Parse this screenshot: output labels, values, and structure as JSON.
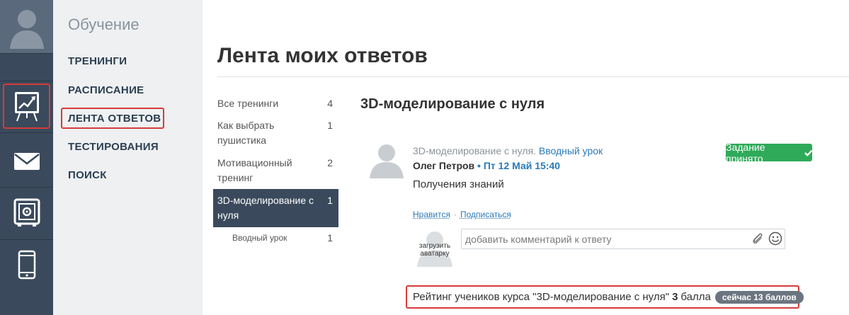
{
  "sidebar": {
    "title": "Обучение",
    "items": [
      {
        "label": "ТРЕНИНГИ"
      },
      {
        "label": "РАСПИСАНИЕ"
      },
      {
        "label": "ЛЕНТА ОТВЕТОВ"
      },
      {
        "label": "ТЕСТИРОВАНИЯ"
      },
      {
        "label": "ПОИСК"
      }
    ]
  },
  "rail": {
    "icons": [
      "avatar-icon",
      "training-chart-icon",
      "mail-icon",
      "safe-icon",
      "phone-icon"
    ],
    "bg": "#3a4a5c",
    "highlight": "#d83a3a"
  },
  "page": {
    "title": "Лента моих ответов"
  },
  "categories": [
    {
      "name": "Все тренинги",
      "count": "4"
    },
    {
      "name": "Как выбрать пушистика",
      "count": "1"
    },
    {
      "name": "Мотивационный тренинг",
      "count": "2"
    },
    {
      "name": "3D-моделирование с нуля",
      "count": "1"
    },
    {
      "name": "Вводный урок",
      "count": "1"
    }
  ],
  "section": {
    "title": "3D-моделирование с нуля"
  },
  "post": {
    "course": "3D-моделирование с нуля.",
    "lesson": "Вводный урок",
    "author": "Олег Петров",
    "separator": "•",
    "date": "Пт 12 Май 15:40",
    "text": "Получения знаний",
    "status_label": "Задание принято",
    "status_color": "#2eaa59",
    "like_label": "Нравится",
    "actions_separator": "·",
    "subscribe_label": "Подписаться"
  },
  "comment": {
    "avatar_label": "загрузить аватарку",
    "placeholder": "добавить комментарий к ответу"
  },
  "rating": {
    "prefix": "Рейтинг учеников курса \"3D-моделирование с нуля\"",
    "points": "3",
    "suffix": "балла",
    "now_label": "сейчас  13 баллов"
  }
}
